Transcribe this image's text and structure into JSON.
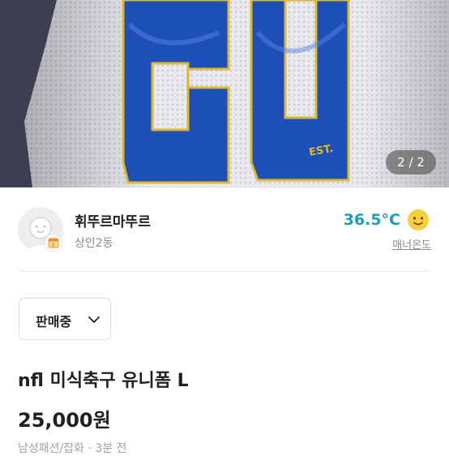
{
  "photo": {
    "description_icon": "jersey-photo",
    "page_indicator": "2 / 2"
  },
  "seller": {
    "name": "휘뚜르마뚜르",
    "location": "상인2동",
    "manner_temperature": "36.5°C",
    "manner_label": "매너온도",
    "temperature_color": "#1f9bbe"
  },
  "item": {
    "status": "판매중",
    "title": "nfl 미식축구 유니폼 L",
    "price": "25,000원",
    "meta": "남성패션/잡화 · 3분 전"
  },
  "colors": {
    "text_primary": "#212124",
    "text_secondary": "#868b94",
    "border": "#dcdee3",
    "jersey_blue": "#1d4fb8",
    "jersey_gold": "#e0b82f"
  }
}
